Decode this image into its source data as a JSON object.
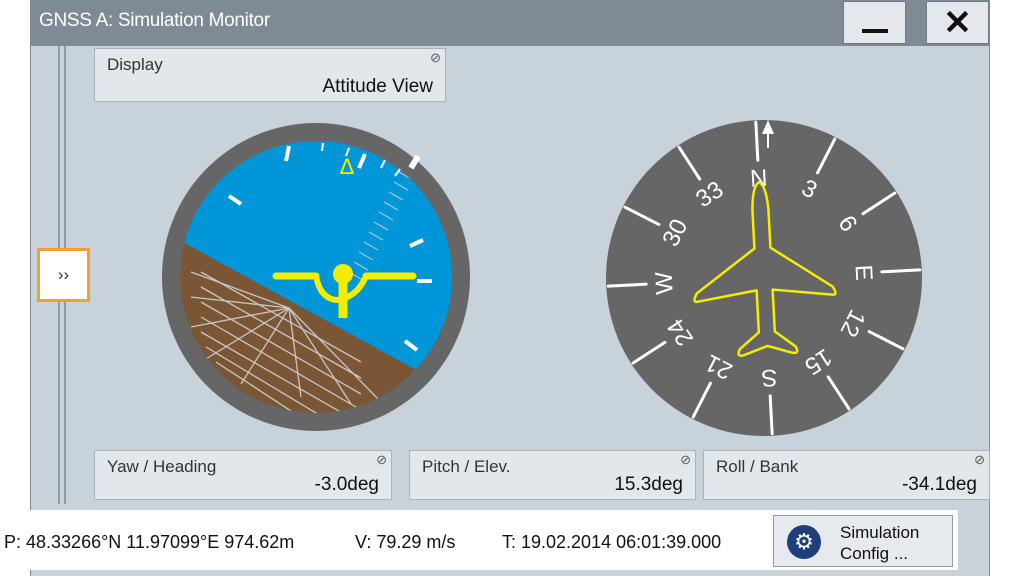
{
  "window": {
    "title": "GNSS A: Simulation Monitor"
  },
  "side_toggle": {
    "label": "››"
  },
  "display": {
    "label": "Display",
    "value": "Attitude View"
  },
  "attitude": {
    "pitch_marker": "Δ"
  },
  "compass": {
    "labels": {
      "n": "N",
      "c3": "3",
      "c6": "6",
      "e": "E",
      "c12": "12",
      "c15": "15",
      "s": "S",
      "c21": "21",
      "c24": "24",
      "w": "W",
      "c30": "30",
      "c33": "33"
    }
  },
  "readouts": {
    "yaw": {
      "label": "Yaw / Heading",
      "value": "-3.0deg"
    },
    "pitch": {
      "label": "Pitch / Elev.",
      "value": "15.3deg"
    },
    "roll": {
      "label": "Roll / Bank",
      "value": "-34.1deg"
    }
  },
  "status": {
    "position": "P: 48.33266°N 11.97099°E 974.62m",
    "velocity": "V: 79.29 m/s",
    "time": "T: 19.02.2014 06:01:39.000"
  },
  "simulation_button": {
    "line1": "Simulation",
    "line2": "Config ..."
  },
  "icons": {
    "link": "link-icon",
    "gear": "gear-icon",
    "minimize": "minimize-icon",
    "close": "close-icon"
  },
  "colors": {
    "sky": "#0096d8",
    "ground": "#7a5634",
    "symbol": "#f5ed00",
    "bezel": "#666666",
    "compass_face": "#666666"
  }
}
